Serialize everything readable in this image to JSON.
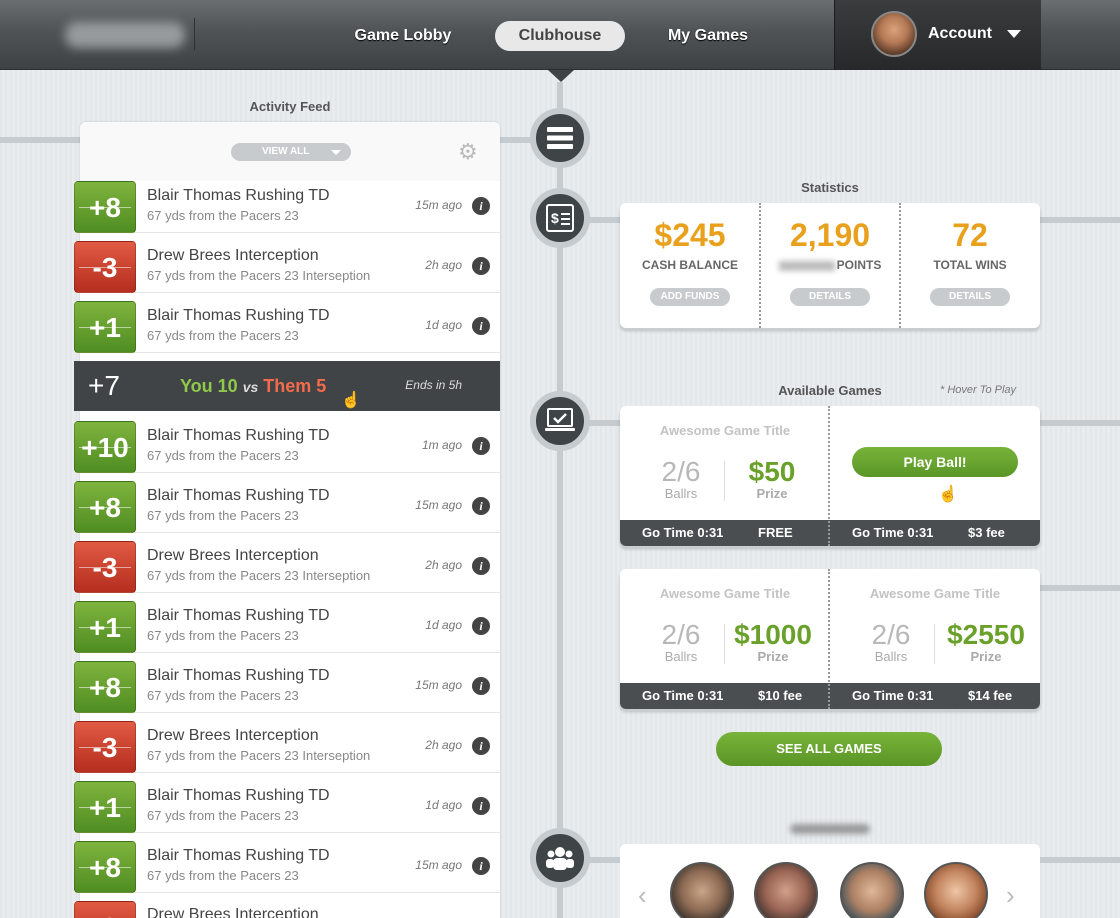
{
  "header": {
    "nav": [
      "Game Lobby",
      "Clubhouse",
      "My Games"
    ],
    "active_nav": "Clubhouse",
    "account_label": "Account"
  },
  "feed": {
    "title": "Activity Feed",
    "view_all": "VIEW ALL",
    "items": [
      {
        "score": "+8",
        "kind": "green",
        "title": "Blair Thomas Rushing TD",
        "sub": "67 yds from the Pacers 23",
        "time": "15m ago"
      },
      {
        "score": "-3",
        "kind": "red",
        "title": "Drew Brees Interception",
        "sub": "67 yds from the Pacers 23 Interseption",
        "time": "2h ago"
      },
      {
        "score": "+1",
        "kind": "green",
        "title": "Blair Thomas Rushing TD",
        "sub": "67 yds from the Pacers 23",
        "time": "1d ago"
      },
      {
        "score": "+10",
        "kind": "green",
        "title": "Blair Thomas Rushing TD",
        "sub": "67 yds from the Pacers 23",
        "time": "1m ago"
      },
      {
        "score": "+8",
        "kind": "green",
        "title": "Blair Thomas Rushing TD",
        "sub": "67 yds from the Pacers 23",
        "time": "15m ago"
      },
      {
        "score": "-3",
        "kind": "red",
        "title": "Drew Brees Interception",
        "sub": "67 yds from the Pacers 23 Interseption",
        "time": "2h ago"
      },
      {
        "score": "+1",
        "kind": "green",
        "title": "Blair Thomas Rushing TD",
        "sub": "67 yds from the Pacers 23",
        "time": "1d ago"
      },
      {
        "score": "+8",
        "kind": "green",
        "title": "Blair Thomas Rushing TD",
        "sub": "67 yds from the Pacers 23",
        "time": "15m ago"
      },
      {
        "score": "-3",
        "kind": "red",
        "title": "Drew Brees Interception",
        "sub": "67 yds from the Pacers 23 Interseption",
        "time": "2h ago"
      },
      {
        "score": "+1",
        "kind": "green",
        "title": "Blair Thomas Rushing TD",
        "sub": "67 yds from the Pacers 23",
        "time": "1d ago"
      },
      {
        "score": "+8",
        "kind": "green",
        "title": "Blair Thomas Rushing TD",
        "sub": "67 yds from the Pacers 23",
        "time": "15m ago"
      },
      {
        "score": "-3",
        "kind": "red",
        "title": "Drew Brees Interception",
        "sub": "",
        "time": ""
      }
    ],
    "matchup": {
      "score": "+7",
      "you": "You 10",
      "vs": "vs",
      "them": "Them 5",
      "ends": "Ends in 5h"
    }
  },
  "stats": {
    "title": "Statistics",
    "items": [
      {
        "value": "$245",
        "label": "CASH BALANCE",
        "button": "ADD FUNDS"
      },
      {
        "value": "2,190",
        "label": "POINTS",
        "button": "DETAILS"
      },
      {
        "value": "72",
        "label": "TOTAL WINS",
        "button": "DETAILS"
      }
    ]
  },
  "games": {
    "title": "Available Games",
    "hover_hint": "* Hover To Play",
    "slots_label": "Ballrs",
    "prize_label": "Prize",
    "play_label": "Play Ball!",
    "items": [
      {
        "title": "Awesome Game Title",
        "slots": "2/6",
        "prize": "$50",
        "go": "Go Time 0:31",
        "fee": "FREE"
      },
      {
        "title": "",
        "slots": "",
        "prize": "",
        "go": "Go Time 0:31",
        "fee": "$3 fee"
      },
      {
        "title": "Awesome Game Title",
        "slots": "2/6",
        "prize": "$1000",
        "go": "Go Time 0:31",
        "fee": "$10 fee"
      },
      {
        "title": "Awesome Game Title",
        "slots": "2/6",
        "prize": "$2550",
        "go": "Go Time 0:31",
        "fee": "$14 fee"
      }
    ],
    "see_all": "SEE ALL GAMES"
  },
  "friends": {
    "prev_icon": "chevron-left-icon",
    "next_icon": "chevron-right-icon"
  },
  "colors": {
    "green": "#5f9a2a",
    "red": "#c93a26",
    "orange": "#e9a11d",
    "dark": "#3f4446"
  }
}
